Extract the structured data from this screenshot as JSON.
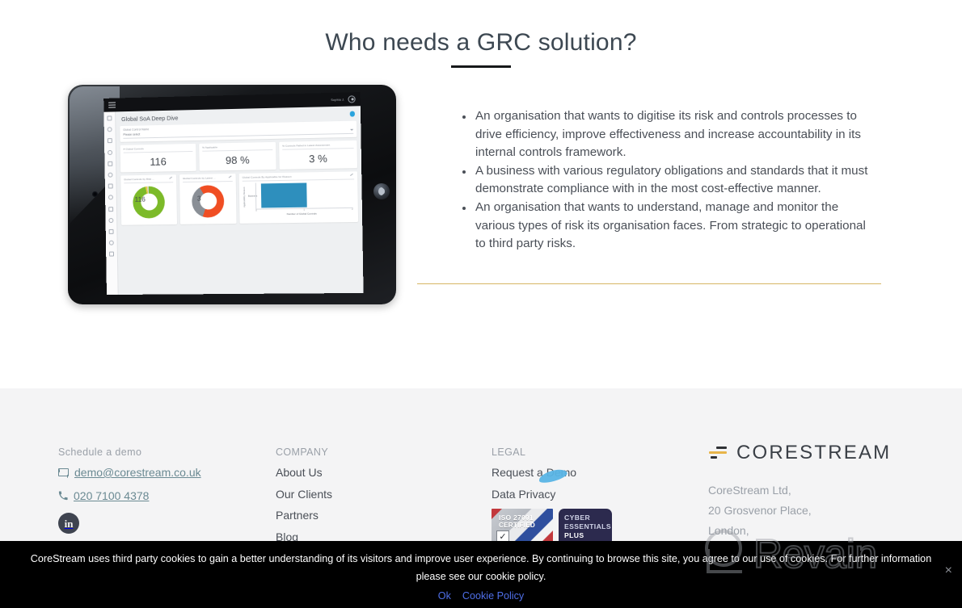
{
  "hero": {
    "title": "Who needs a GRC solution?",
    "bullets": [
      "An organisation that wants to digitise its risk and controls processes to drive efficiency, improve effectiveness and increase accountability in its internal controls framework.",
      "A business with various regulatory obligations and standards that it must demonstrate compliance with in the most cost-effective manner.",
      "An organisation that wants to understand, manage and monitor the various types of risk its organisation faces. From strategic to operational to third party risks."
    ]
  },
  "tablet": {
    "topbar": {
      "user": "Sophia J."
    },
    "dashboard": {
      "title": "Global SoA Deep Dive",
      "filter_label": "Global Control Name",
      "filter_value": "Please select",
      "kpis": [
        {
          "label": "# Global Controls",
          "value": "116"
        },
        {
          "label": "% Applicable",
          "value": "98 %"
        },
        {
          "label": "% Controls Failed in Latest Assessment",
          "value": "3 %"
        }
      ],
      "charts": [
        {
          "title": "Global Controls by Risk ...",
          "value": "116"
        },
        {
          "title": "Global Controls by Latest ...",
          "value": "3"
        },
        {
          "title": "Global Controls By Applicable for Reason",
          "ylabel": "Applicability Reason",
          "category": "Business",
          "xlabel": "Number of Global Controls",
          "xticks": [
            "0",
            "1",
            "2"
          ]
        }
      ]
    }
  },
  "footer": {
    "contact": {
      "heading": "Schedule a demo",
      "email": "demo@corestream.co.uk",
      "phone": "020 7100 4378",
      "social": "in"
    },
    "company": {
      "heading": "COMPANY",
      "links": [
        "About Us",
        "Our Clients",
        "Partners",
        "Blog"
      ]
    },
    "legal": {
      "heading": "LEGAL",
      "links": [
        "Request a Demo",
        "Data Privacy"
      ],
      "badges": [
        {
          "line1": "ISO 27001",
          "line2": "CERTIFIED",
          "mark": "✓"
        },
        {
          "line1": "CYBER",
          "line2": "ESSENTIALS",
          "line3": "PLUS"
        }
      ]
    },
    "brand": {
      "name": "CORESTREAM",
      "address": [
        "CoreStream Ltd,",
        "20 Grosvenor Place,",
        "London,"
      ]
    }
  },
  "cookie": {
    "message": "CoreStream uses third party cookies to gain a better understanding of its visitors and improve user experience. By continuing to browse this site, you agree to our use of cookies. For further information please see our cookie policy.",
    "ok": "Ok",
    "policy": "Cookie Policy",
    "close": "×"
  },
  "watermark": {
    "text": "Revain"
  },
  "colors": {
    "accent_gold": "#cfa94a",
    "link_blue": "#4f6fe8",
    "contact_teal": "#6b8a93",
    "heading_slate": "#3d4852",
    "donut_green": "#7cba29",
    "donut_orange": "#f04e23",
    "bar_blue": "#2e8fbd"
  }
}
